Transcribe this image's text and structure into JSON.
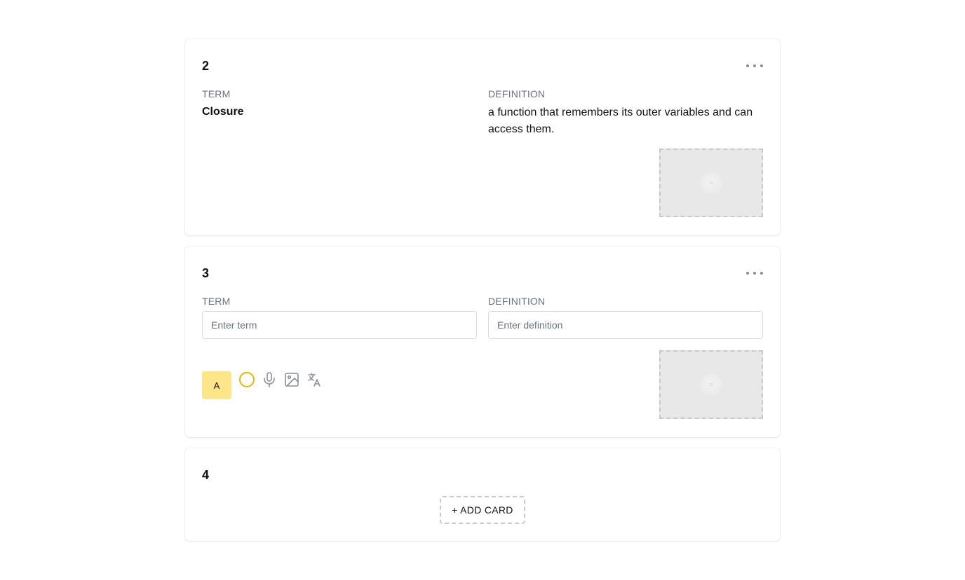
{
  "cards": [
    {
      "number": "2",
      "term_label": "TERM",
      "definition_label": "DEFINITION",
      "term": "Closure",
      "definition": "a function that remembers its outer variables and can access them."
    },
    {
      "number": "3",
      "term_label": "TERM",
      "definition_label": "DEFINITION",
      "term_placeholder": "Enter term",
      "definition_placeholder": "Enter definition",
      "format_button_label": "A"
    },
    {
      "number": "4",
      "add_card_label": "+ ADD CARD"
    }
  ],
  "icons": {
    "menu": "more-horizontal-icon",
    "color": "circle-color-icon",
    "audio": "microphone-icon",
    "image": "image-icon",
    "translate": "translate-icon",
    "image_placeholder": "image-placeholder-icon"
  },
  "colors": {
    "highlight": "#fde68a",
    "color_ring": "#eab308",
    "icon_gray": "#8a8f98",
    "label_gray": "#6b7280"
  }
}
